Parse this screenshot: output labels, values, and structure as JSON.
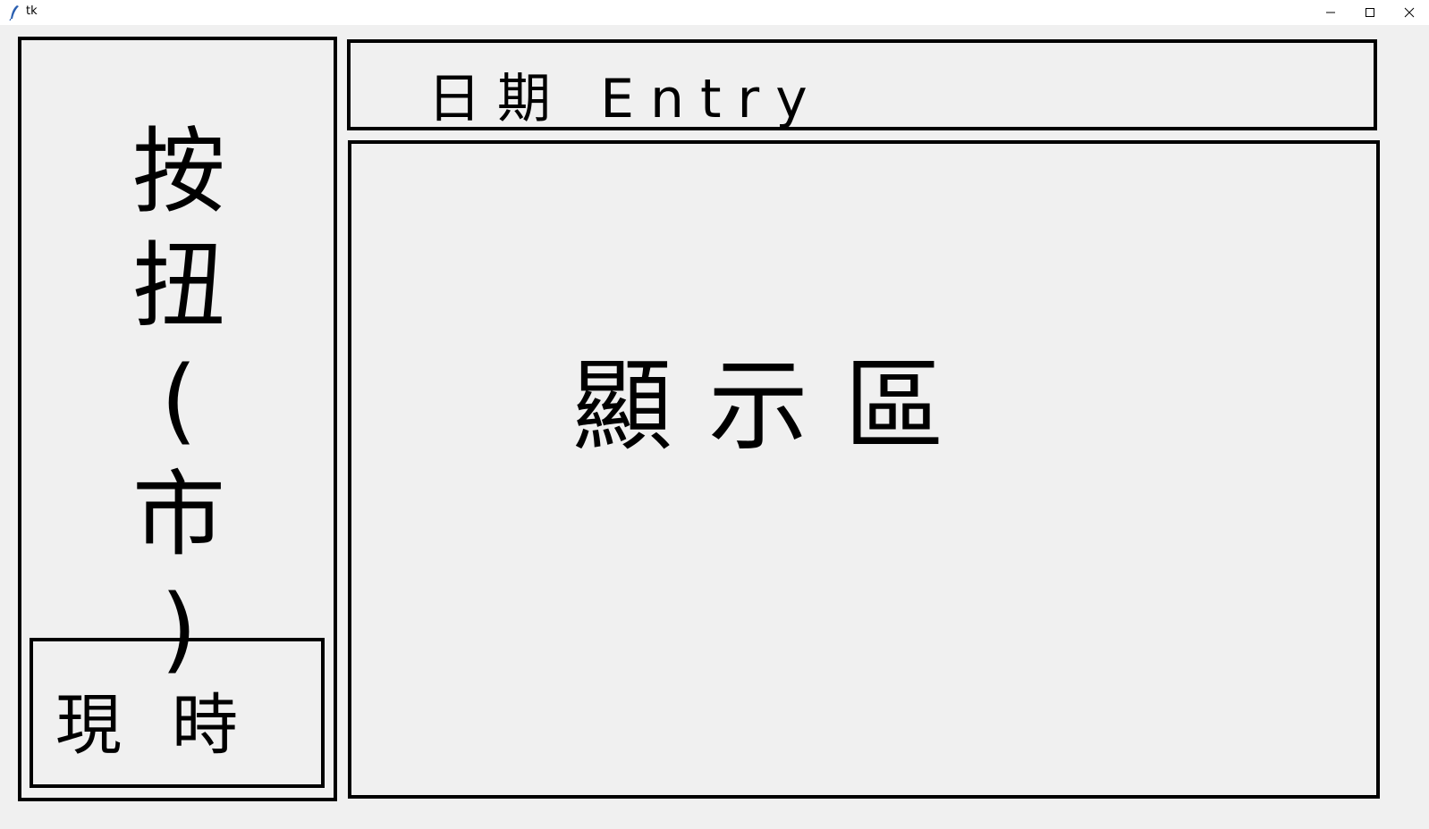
{
  "window": {
    "title": "tk",
    "controls": {
      "minimize_icon": "minimize-icon",
      "maximize_icon": "maximize-icon",
      "close_icon": "close-icon"
    }
  },
  "top_panel": {
    "label": "日期 Entry"
  },
  "left_panel": {
    "buttons_area": {
      "lines": [
        "按",
        "扭",
        "(",
        "市",
        ")"
      ]
    },
    "now_button": {
      "label": "現時"
    }
  },
  "main_panel": {
    "label": "顯示區"
  }
}
